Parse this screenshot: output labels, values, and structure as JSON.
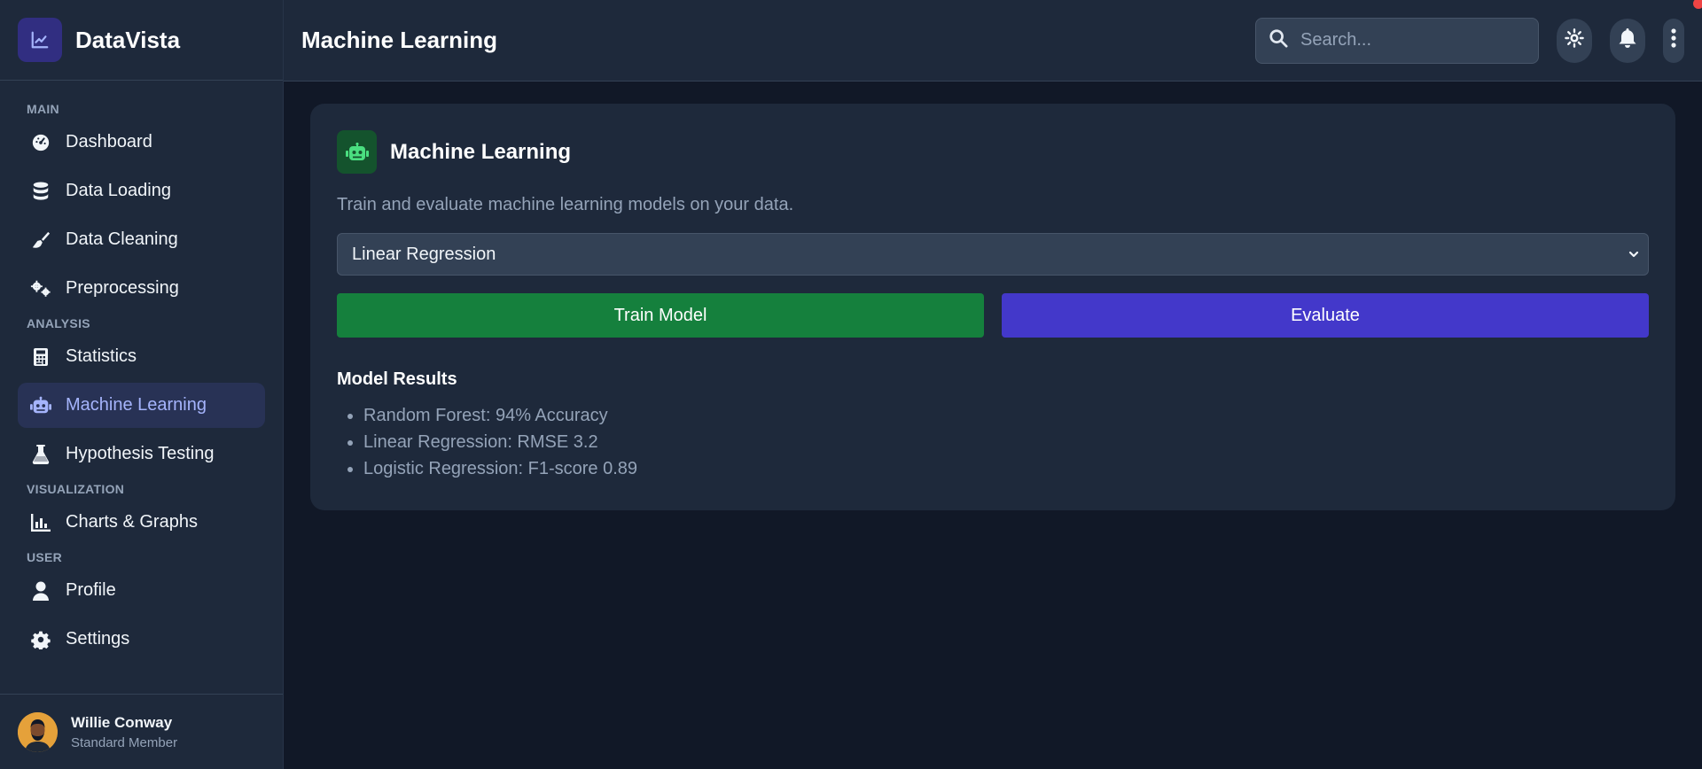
{
  "brand": {
    "name": "DataVista",
    "accent": "#312e81"
  },
  "sidebar": {
    "sections": [
      {
        "label": "MAIN"
      },
      {
        "label": "ANALYSIS"
      },
      {
        "label": "VISUALIZATION"
      },
      {
        "label": "USER"
      }
    ],
    "items": [
      {
        "label": "Dashboard",
        "icon": "gauge-icon"
      },
      {
        "label": "Data Loading",
        "icon": "database-icon"
      },
      {
        "label": "Data Cleaning",
        "icon": "broom-icon"
      },
      {
        "label": "Preprocessing",
        "icon": "cogs-icon"
      },
      {
        "label": "Statistics",
        "icon": "calculator-icon"
      },
      {
        "label": "Machine Learning",
        "icon": "robot-icon",
        "active": true
      },
      {
        "label": "Hypothesis Testing",
        "icon": "flask-icon"
      },
      {
        "label": "Charts & Graphs",
        "icon": "chart-bar-icon"
      },
      {
        "label": "Profile",
        "icon": "user-icon"
      },
      {
        "label": "Settings",
        "icon": "gear-icon"
      }
    ],
    "active_color": "#a5b4fc"
  },
  "user": {
    "name": "Willie Conway",
    "role": "Standard Member"
  },
  "header": {
    "title": "Machine Learning",
    "search_placeholder": "Search..."
  },
  "card": {
    "title": "Machine Learning",
    "description": "Train and evaluate machine learning models on your data.",
    "selected_model": "Linear Regression",
    "train_label": "Train Model",
    "evaluate_label": "Evaluate",
    "train_color": "#15803d",
    "evaluate_color": "#4338ca",
    "results_title": "Model Results",
    "results": [
      "Random Forest: 94% Accuracy",
      "Linear Regression: RMSE 3.2",
      "Logistic Regression: F1-score 0.89"
    ]
  }
}
